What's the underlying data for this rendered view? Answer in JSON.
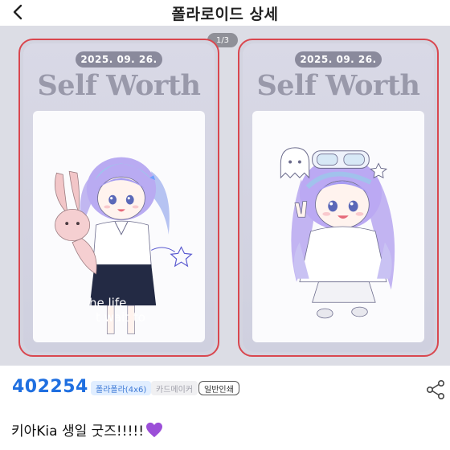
{
  "header": {
    "title": "폴라로이드 상세",
    "page_indicator": "1/3",
    "back_icon": "chevron-left-icon"
  },
  "gallery": {
    "cards": [
      {
        "date": "2025. 09. 26.",
        "title": "Self Worth",
        "overlay_lines": [
          "he life",
          "t wait to"
        ]
      },
      {
        "date": "2025. 09. 26.",
        "title": "Self Worth",
        "overlay_lines": []
      }
    ],
    "frame_color": "#d9474f"
  },
  "info": {
    "price": "402254",
    "tags": [
      "폴라폴라(4x6)",
      "카드메이커",
      "일반인쇄"
    ],
    "share_icon": "share-icon",
    "price_color": "#1f6fe0"
  },
  "post": {
    "title": "키아Kia 생일 굿즈!!!!!",
    "emoji": "purple-heart-icon"
  }
}
